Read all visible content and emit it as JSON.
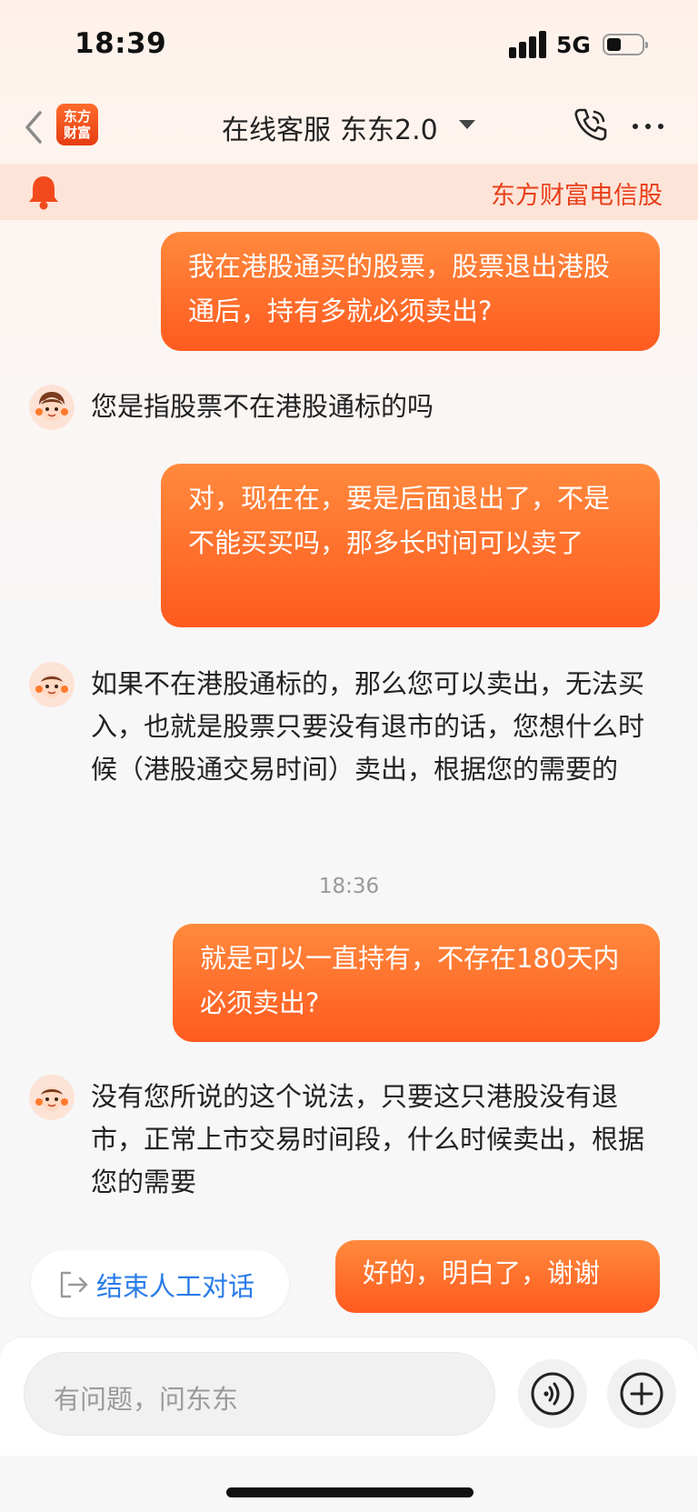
{
  "status": {
    "time": "18:39",
    "network": "5G"
  },
  "header": {
    "logo_line1": "东方",
    "logo_line2": "财富",
    "title": "在线客服",
    "version": "东东2.0"
  },
  "notice": {
    "text": "东方财富电信股"
  },
  "messages": [
    {
      "from": "user",
      "text": "我在港股通买的股票，股票退出港股通后，持有多就必须卖出?"
    },
    {
      "from": "agent",
      "text": "您是指股票不在港股通标的吗"
    },
    {
      "from": "user",
      "text": "对，现在在，要是后面退出了，不是不能买买吗，那多长时间可以卖了"
    },
    {
      "from": "agent",
      "text": "如果不在港股通标的，那么您可以卖出，无法买入，也就是股票只要没有退市的话，您想什么时候（港股通交易时间）卖出，根据您的需要的"
    },
    {
      "from": "user",
      "text": "就是可以一直持有，不存在180天内必须卖出?"
    },
    {
      "from": "agent",
      "text": "没有您所说的这个说法，只要这只港股没有退市，正常上市交易时间段，什么时候卖出，根据您的需要"
    },
    {
      "from": "user",
      "text": "好的，明白了，谢谢"
    }
  ],
  "timestamp": "18:36",
  "actions": {
    "end_chat": "结束人工对话"
  },
  "composer": {
    "placeholder": "有问题，问东东"
  },
  "colors": {
    "accent": "#ff5a1f",
    "link": "#2a7ce8",
    "notice_bg": "#fde4d8"
  },
  "icons": [
    "back-chevron-icon",
    "phone-call-icon",
    "more-dots-icon",
    "bell-icon",
    "exit-icon",
    "voice-icon",
    "plus-icon"
  ]
}
